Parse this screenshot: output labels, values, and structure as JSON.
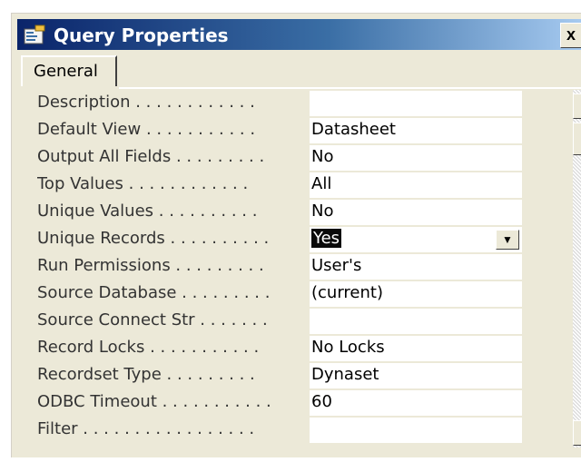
{
  "window": {
    "title": "Query Properties",
    "close_label": "x",
    "tab_label": "General"
  },
  "properties": [
    {
      "label": "Description",
      "dots": " . . . . . . . . . . . .",
      "value": ""
    },
    {
      "label": "Default View",
      "dots": " . . . . . . . . . . .",
      "value": "Datasheet"
    },
    {
      "label": "Output All Fields",
      "dots": " . . . . . . . . .",
      "value": "No"
    },
    {
      "label": "Top Values",
      "dots": " . . . . . . . . . . . .",
      "value": "All"
    },
    {
      "label": "Unique Values",
      "dots": " . . . . . . . . . .",
      "value": "No"
    },
    {
      "label": "Unique Records",
      "dots": " . . . . . . . . . .",
      "value": "Yes"
    },
    {
      "label": "Run Permissions",
      "dots": " . . . . . . . . .",
      "value": "User's"
    },
    {
      "label": "Source Database",
      "dots": " . . . . . . . . .",
      "value": "(current)"
    },
    {
      "label": "Source Connect Str",
      "dots": " . . . . . . .",
      "value": ""
    },
    {
      "label": "Record Locks",
      "dots": " . . . . . . . . . . .",
      "value": "No Locks"
    },
    {
      "label": "Recordset Type",
      "dots": " . . . . . . . . .",
      "value": "Dynaset"
    },
    {
      "label": "ODBC Timeout",
      "dots": " . . . . . . . . . . .",
      "value": "60"
    },
    {
      "label": "Filter",
      "dots": " . . . . . . . . . . . . . . . . .",
      "value": ""
    }
  ],
  "selected_row_index": 5,
  "icons": {
    "window_icon": "properties-icon",
    "dropdown": "chevron-down-icon",
    "scroll_up": "arrow-up-icon",
    "scroll_down": "arrow-down-icon"
  },
  "colors": {
    "titlebar_start": "#0a246a",
    "titlebar_end": "#a6caf0",
    "panel": "#ece9d8"
  }
}
